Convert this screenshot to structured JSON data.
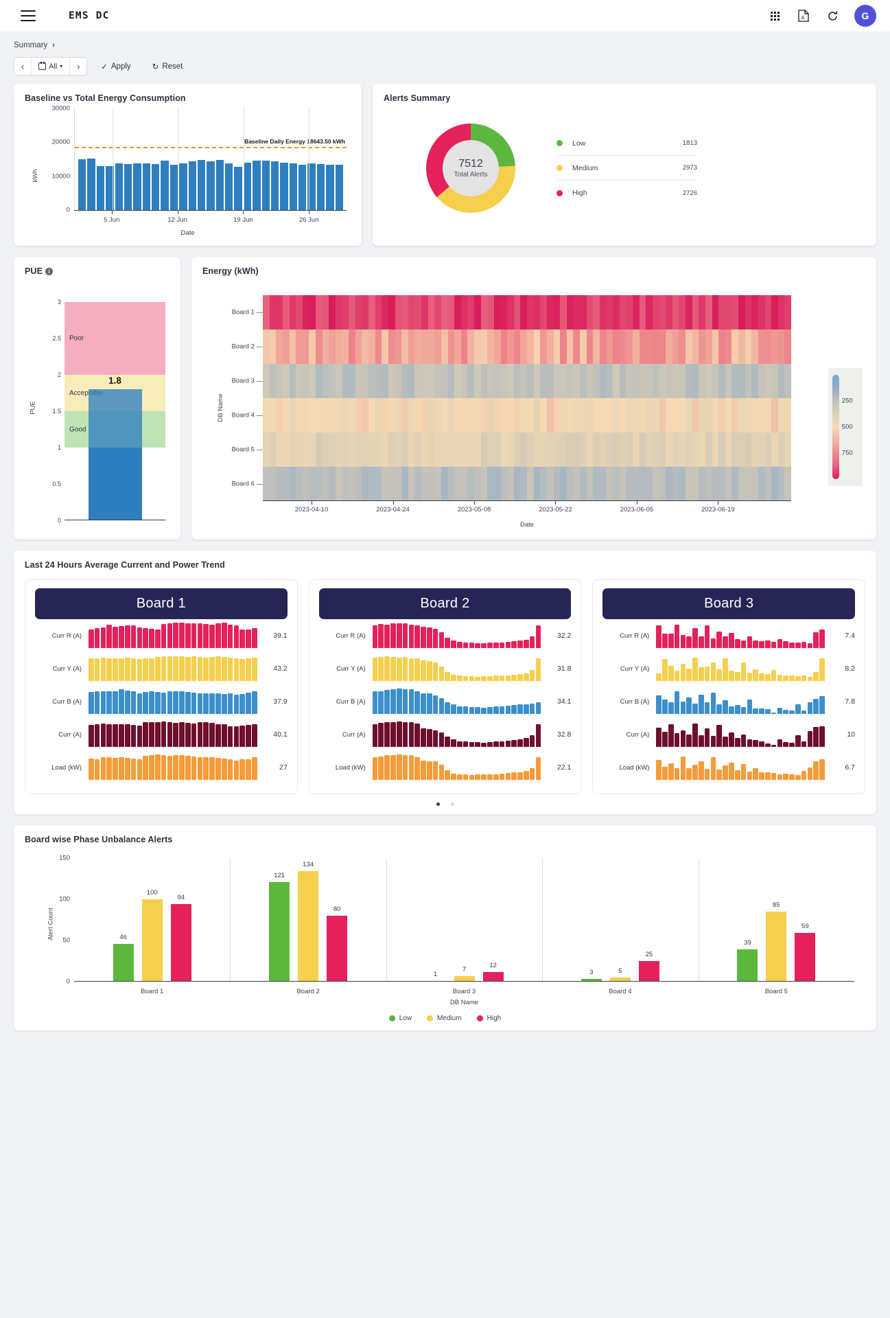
{
  "header": {
    "app_title": "EMS  DC",
    "menu_icon": "hamburger-icon",
    "apps_icon": "grid-apps-icon",
    "pdf_icon": "pdf-export-icon",
    "refresh_icon": "refresh-icon",
    "avatar_initial": "G"
  },
  "breadcrumb": {
    "label": "Summary",
    "chevron": "›"
  },
  "filters": {
    "prev": "‹",
    "next": "›",
    "range_label": "All",
    "caret": "∨",
    "apply_label": "Apply",
    "apply_icon": "check-icon",
    "reset_label": "Reset",
    "reset_icon": "reset-icon"
  },
  "panels": {
    "baseline_title": "Baseline vs Total Energy Consumption",
    "alerts_title": "Alerts Summary",
    "pue_title": "PUE",
    "pue_info": "i",
    "energy_title": "Energy (kWh)",
    "trend_title": "Last 24 Hours Average Current and Power Trend",
    "unbalance_title": "Board wise Phase Unbalance Alerts"
  },
  "chart_data": [
    {
      "id": "baseline_vs_total",
      "type": "bar",
      "title": "Baseline vs Total Energy Consumption",
      "xlabel": "Date",
      "ylabel": "kWh",
      "ylim": [
        0,
        30000
      ],
      "yticks": [
        0,
        10000,
        20000,
        30000
      ],
      "xticks": [
        "5 Jun",
        "12 Jun",
        "19 Jun",
        "26 Jun"
      ],
      "bar_color": "#2f7fbf",
      "baseline": {
        "value": 18643.5,
        "label": "Baseline Daily Energy 18643.50 kWh",
        "color": "#f0941f",
        "style": "dashed"
      },
      "values": [
        15100,
        15250,
        12900,
        13000,
        13700,
        13500,
        13800,
        13700,
        13500,
        14500,
        13400,
        13800,
        14400,
        14700,
        14400,
        14800,
        13700,
        12800,
        13900,
        14500,
        14500,
        14300,
        14000,
        13800,
        13400,
        13800,
        13600,
        13300,
        13300
      ]
    },
    {
      "id": "alerts_summary",
      "type": "pie",
      "title": "Alerts Summary",
      "center_value": "7512",
      "center_label": "Total Alerts",
      "total": 7512,
      "labels": [
        "Low",
        "Medium",
        "High"
      ],
      "values": [
        1813,
        2973,
        2726
      ],
      "colors": [
        "#5cb73e",
        "#f5cf4e",
        "#e4215b"
      ],
      "legend_position": "right"
    },
    {
      "id": "pue_gauge",
      "type": "bar",
      "title": "PUE",
      "ylabel": "PUE",
      "ylim": [
        0,
        3
      ],
      "yticks": [
        0,
        0.5,
        1,
        1.5,
        2,
        2.5,
        3
      ],
      "value": 1.8,
      "value_label": "1.8",
      "bar_color": "#2f7fbf",
      "bands": [
        {
          "label": "Good",
          "from": 1.0,
          "to": 1.5,
          "color": "#bfe3b5"
        },
        {
          "label": "Acceptable",
          "from": 1.5,
          "to": 2.0,
          "color": "#f8edba"
        },
        {
          "label": "Poor",
          "from": 2.0,
          "to": 3.0,
          "color": "#f4aebf"
        }
      ]
    },
    {
      "id": "energy_heatmap",
      "type": "heatmap",
      "title": "Energy (kWh)",
      "xlabel": "Date",
      "ylabel": "DB Name",
      "rows": [
        "Board 1",
        "Board 2",
        "Board 3",
        "Board 4",
        "Board 5",
        "Board 6"
      ],
      "xticks": [
        "2023-04-10",
        "2023-04-24",
        "2023-05-08",
        "2023-05-22",
        "2023-06-05",
        "2023-06-19"
      ],
      "colorbar": {
        "ticks": [
          250,
          500,
          750
        ],
        "low_color": "#7da7d2",
        "mid_color": "#e8d6b4",
        "high_color": "#d81e5b"
      },
      "row_level": [
        760,
        560,
        200,
        430,
        330,
        170
      ]
    },
    {
      "id": "phase_unbalance",
      "type": "bar",
      "title": "Board wise Phase Unbalance Alerts",
      "xlabel": "DB Name",
      "ylabel": "Alert Count",
      "ylim": [
        0,
        150
      ],
      "yticks": [
        0,
        50,
        100,
        150
      ],
      "categories": [
        "Board 1",
        "Board 2",
        "Board 3",
        "Board 4",
        "Board 5"
      ],
      "legend_position": "bottom",
      "series": [
        {
          "name": "Low",
          "color": "#5cb73e",
          "values": [
            46,
            121,
            1,
            3,
            39
          ]
        },
        {
          "name": "Medium",
          "color": "#f5cf4e",
          "values": [
            100,
            134,
            7,
            5,
            85
          ]
        },
        {
          "name": "High",
          "color": "#e4215b",
          "values": [
            94,
            80,
            12,
            25,
            59
          ]
        }
      ]
    }
  ],
  "boards": [
    {
      "name": "Board 1",
      "metrics": [
        {
          "label": "Curr R (A)",
          "value": "39.1",
          "color": "#e4215b",
          "spark": [
            72,
            76,
            80,
            90,
            82,
            84,
            86,
            88,
            80,
            76,
            74,
            72,
            92,
            96,
            98,
            97,
            95,
            94,
            96,
            92,
            90,
            94,
            98,
            90,
            86,
            70,
            72,
            76
          ]
        },
        {
          "label": "Curr Y (A)",
          "value": "43.2",
          "color": "#f5cf4e",
          "spark": [
            86,
            88,
            90,
            88,
            86,
            88,
            90,
            86,
            84,
            86,
            88,
            92,
            94,
            96,
            95,
            94,
            93,
            94,
            92,
            90,
            92,
            94,
            92,
            90,
            88,
            84,
            86,
            90
          ]
        },
        {
          "label": "Curr B (A)",
          "value": "37.9",
          "color": "#3b8fcc",
          "spark": [
            84,
            86,
            88,
            86,
            88,
            94,
            90,
            88,
            80,
            84,
            86,
            84,
            82,
            86,
            88,
            86,
            84,
            82,
            80,
            78,
            80,
            78,
            76,
            78,
            74,
            76,
            82,
            86
          ]
        },
        {
          "label": "Curr (A)",
          "value": "40.1",
          "color": "#6e0f2c",
          "spark": [
            84,
            88,
            90,
            88,
            86,
            88,
            86,
            84,
            82,
            96,
            94,
            96,
            98,
            94,
            92,
            94,
            92,
            90,
            94,
            96,
            92,
            88,
            86,
            80,
            78,
            82,
            84,
            88
          ]
        },
        {
          "label": "Load (kW)",
          "value": "27",
          "color": "#f79b39",
          "spark": [
            82,
            80,
            88,
            86,
            84,
            86,
            84,
            82,
            80,
            92,
            96,
            98,
            94,
            92,
            94,
            96,
            92,
            90,
            88,
            86,
            88,
            84,
            82,
            80,
            74,
            78,
            80,
            88
          ]
        }
      ]
    },
    {
      "name": "Board 2",
      "metrics": [
        {
          "label": "Curr R (A)",
          "value": "32.2",
          "color": "#e4215b",
          "spark": [
            88,
            92,
            90,
            94,
            96,
            94,
            90,
            88,
            82,
            78,
            74,
            60,
            40,
            28,
            24,
            22,
            20,
            18,
            18,
            20,
            22,
            22,
            24,
            26,
            28,
            32,
            46,
            88
          ]
        },
        {
          "label": "Curr Y (A)",
          "value": "31.8",
          "color": "#f5cf4e",
          "spark": [
            90,
            92,
            94,
            92,
            90,
            92,
            88,
            86,
            80,
            76,
            70,
            54,
            34,
            24,
            20,
            18,
            18,
            16,
            18,
            18,
            20,
            20,
            22,
            24,
            26,
            30,
            42,
            86
          ]
        },
        {
          "label": "Curr B (A)",
          "value": "34.1",
          "color": "#3b8fcc",
          "spark": [
            86,
            88,
            92,
            94,
            98,
            94,
            96,
            86,
            80,
            78,
            72,
            60,
            44,
            36,
            30,
            28,
            26,
            26,
            24,
            26,
            28,
            30,
            32,
            34,
            36,
            38,
            40,
            44
          ]
        },
        {
          "label": "Curr (A)",
          "value": "32.8",
          "color": "#6e0f2c",
          "spark": [
            88,
            92,
            94,
            96,
            98,
            96,
            94,
            90,
            72,
            68,
            64,
            56,
            40,
            28,
            22,
            20,
            18,
            18,
            16,
            18,
            20,
            22,
            24,
            26,
            28,
            34,
            46,
            88
          ]
        },
        {
          "label": "Load (kW)",
          "value": "22.1",
          "color": "#f79b39",
          "spark": [
            86,
            90,
            94,
            96,
            98,
            96,
            94,
            86,
            74,
            72,
            70,
            58,
            36,
            24,
            22,
            20,
            18,
            20,
            22,
            20,
            22,
            24,
            26,
            28,
            30,
            34,
            46,
            88
          ]
        }
      ]
    },
    {
      "name": "Board 3",
      "metrics": [
        {
          "label": "Curr R (A)",
          "value": "7.4",
          "color": "#e4215b",
          "spark": [
            86,
            56,
            54,
            90,
            50,
            46,
            76,
            44,
            88,
            38,
            64,
            46,
            58,
            34,
            30,
            44,
            28,
            26,
            30,
            24,
            34,
            26,
            22,
            20,
            24,
            18,
            60,
            72
          ]
        },
        {
          "label": "Curr Y (A)",
          "value": "8.2",
          "color": "#f5cf4e",
          "spark": [
            28,
            84,
            58,
            40,
            66,
            48,
            90,
            52,
            54,
            72,
            44,
            86,
            40,
            34,
            70,
            32,
            46,
            30,
            26,
            42,
            24,
            22,
            20,
            18,
            22,
            16,
            34,
            88
          ]
        },
        {
          "label": "Curr B (A)",
          "value": "7.8",
          "color": "#3b8fcc",
          "spark": [
            70,
            56,
            44,
            86,
            48,
            62,
            40,
            74,
            44,
            82,
            36,
            52,
            30,
            34,
            26,
            56,
            22,
            20,
            18,
            6,
            24,
            16,
            14,
            38,
            12,
            44,
            58,
            68
          ]
        },
        {
          "label": "Curr (A)",
          "value": "10",
          "color": "#6e0f2c",
          "spark": [
            74,
            58,
            86,
            52,
            64,
            48,
            90,
            44,
            70,
            42,
            84,
            40,
            56,
            34,
            48,
            30,
            26,
            22,
            14,
            8,
            28,
            18,
            16,
            46,
            20,
            60,
            76,
            80
          ]
        },
        {
          "label": "Load (kW)",
          "value": "6.7",
          "color": "#f79b39",
          "spark": [
            76,
            50,
            62,
            46,
            90,
            44,
            58,
            72,
            42,
            86,
            40,
            54,
            66,
            36,
            60,
            32,
            44,
            30,
            28,
            26,
            22,
            24,
            20,
            18,
            34,
            48,
            70,
            78
          ]
        }
      ]
    }
  ],
  "carousel": {
    "dots": 2,
    "active": 0
  }
}
